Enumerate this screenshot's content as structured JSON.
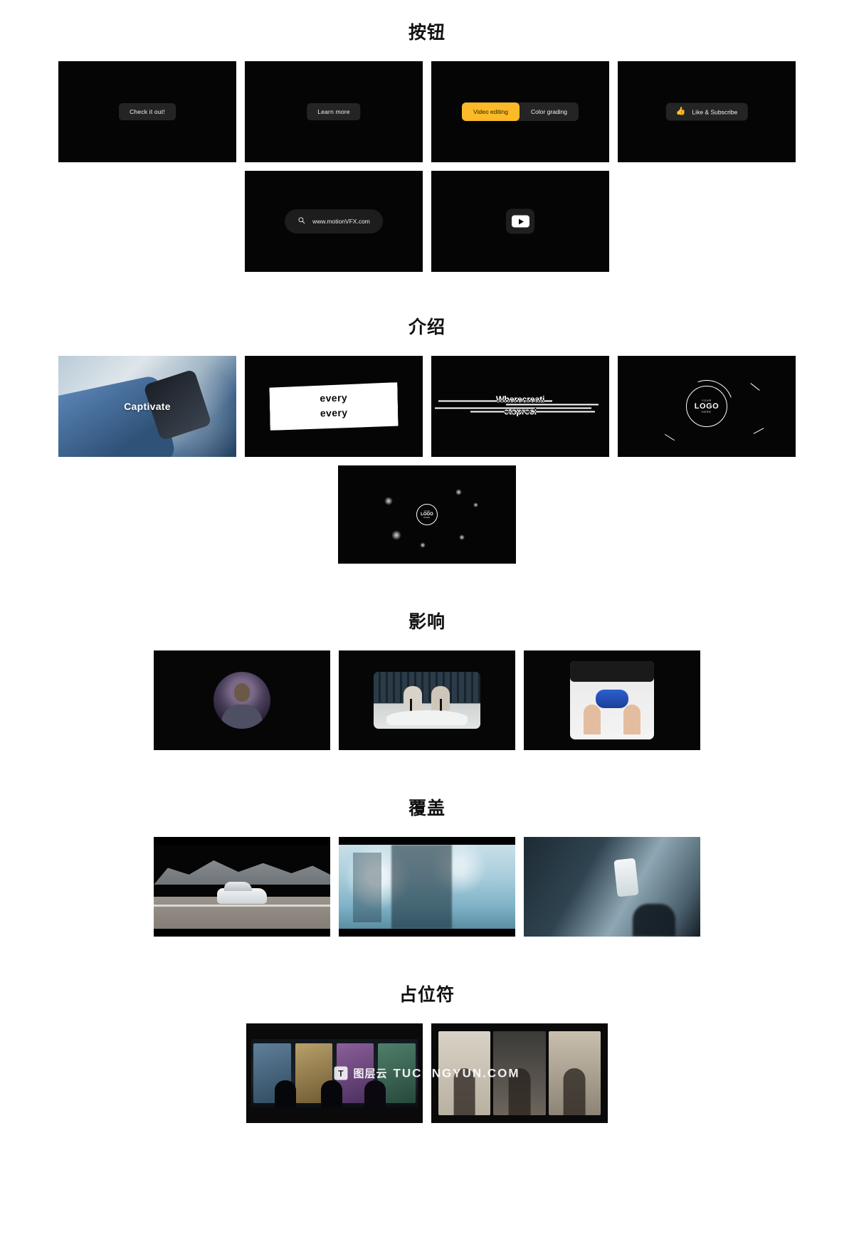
{
  "sections": [
    {
      "id": "buttons",
      "title": "按钮",
      "rows": [
        {
          "cards": [
            {
              "name": "check-it-out",
              "kind": "pill",
              "label": "Check it out!"
            },
            {
              "name": "learn-more",
              "kind": "pill",
              "label": "Learn more"
            },
            {
              "name": "segmented-toggle",
              "kind": "segmented",
              "active_label": "Video editing",
              "inactive_label": "Color grading",
              "active_color": "#fcba29"
            },
            {
              "name": "like-subscribe",
              "kind": "like",
              "icon": "thumbs-up-icon",
              "label": "Like & Subscribe",
              "icon_color": "#fcba29"
            }
          ]
        },
        {
          "cards": [
            {
              "name": "search-url-bar",
              "kind": "search",
              "icon": "search-icon",
              "value": "www.motionVFX.com"
            },
            {
              "name": "youtube-play-button",
              "kind": "youtube",
              "icon": "youtube-play-icon"
            }
          ]
        }
      ]
    },
    {
      "id": "intro",
      "title": "介绍",
      "rows": [
        {
          "cards": [
            {
              "name": "captivate-photo",
              "kind": "photo-captivate",
              "label": "Captivate"
            },
            {
              "name": "every-every-title",
              "kind": "every",
              "line1": "every",
              "line2": "every"
            },
            {
              "name": "stripes-title",
              "kind": "stripes",
              "line1": "Wherecreati",
              "line2": "etspreci"
            },
            {
              "name": "logo-reveal-ring",
              "kind": "logo-ring",
              "top": "YOUR",
              "main": "LOGO",
              "sub": "HERE"
            }
          ]
        },
        {
          "cards": [
            {
              "name": "logo-bokeh",
              "kind": "logo-bokeh",
              "top": "YOUR",
              "main": "LOGO",
              "sub": "HERE"
            }
          ]
        }
      ]
    },
    {
      "id": "influence",
      "title": "影响",
      "rows": [
        {
          "cards": [
            {
              "name": "circle-portrait-clip",
              "kind": "circle-portrait"
            },
            {
              "name": "podcast-interview-clip",
              "kind": "podcast"
            },
            {
              "name": "gaming-controller-clip",
              "kind": "gaming"
            }
          ]
        }
      ]
    },
    {
      "id": "overlay",
      "title": "覆盖",
      "rows": [
        {
          "cards": [
            {
              "name": "car-on-road-clip",
              "kind": "road"
            },
            {
              "name": "frosted-window-clip",
              "kind": "frost"
            },
            {
              "name": "phone-in-hand-clip",
              "kind": "phone"
            }
          ]
        }
      ]
    },
    {
      "id": "placeholder",
      "title": "占位符",
      "rows": [
        {
          "cards": [
            {
              "name": "editing-studio-clip",
              "kind": "studio"
            },
            {
              "name": "three-person-grid-clip",
              "kind": "grid"
            }
          ]
        }
      ]
    }
  ],
  "watermark": {
    "badge": "T",
    "cn": "图层云",
    "en": "TUCENGYUN.COM"
  }
}
